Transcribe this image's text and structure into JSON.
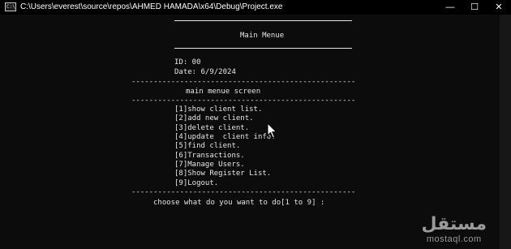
{
  "window": {
    "title": "C:\\Users\\everest\\source\\repos\\AHMED HAMADA\\x64\\Debug\\Project.exe",
    "app_icon_text": "C:\\",
    "minimize": "—",
    "maximize": "☐",
    "close": "✕"
  },
  "console": {
    "header_title": "Main Menue",
    "id_line": "ID: 00",
    "date_line": "Date: 6/9/2024",
    "dash_line": "---------------------------------------------------",
    "screen_title": "main menue screen",
    "menu_items": [
      "[1]show client list.",
      "[2]add new client.",
      "[3]delete client.",
      "[4]update  client info.",
      "[5]find client.",
      "[6]Transactions.",
      "[7]Manage Users.",
      "[8]Show Register List.",
      "[9]Logout."
    ],
    "prompt": "choose what do you want to do[1 to 9] :"
  },
  "watermark": {
    "arabic": "مستقل",
    "latin": "mostaql.com"
  }
}
